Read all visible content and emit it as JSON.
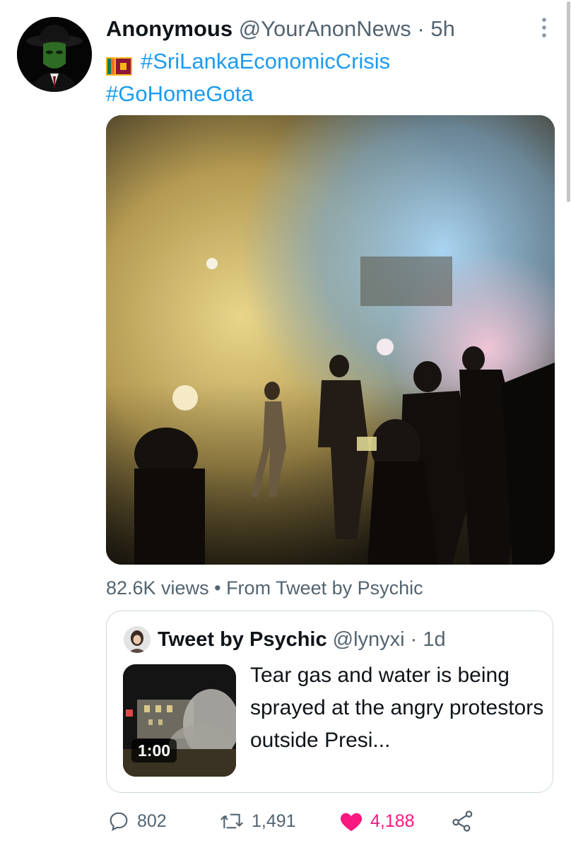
{
  "tweet": {
    "author_name": "Anonymous",
    "handle": "@YourAnonNews",
    "separator": "·",
    "time": "5h",
    "hashtag1": "#SriLankaEconomicCrisis",
    "hashtag2": "#GoHomeGota",
    "flag_icon": "sri-lanka-flag-icon"
  },
  "media": {
    "views": "82.6K views",
    "bullet": "•",
    "source": "From Tweet by Psychic"
  },
  "quote": {
    "label": "Tweet by Psychic",
    "handle": "@lynyxi",
    "separator": "·",
    "time": "1d",
    "text": "Tear gas and water is being sprayed at the angry protestors outside Presi...",
    "duration": "1:00"
  },
  "actions": {
    "replies": "802",
    "retweets": "1,491",
    "likes": "4,188"
  },
  "colors": {
    "link": "#1d9bf0",
    "like": "#f91880",
    "secondary": "#536471",
    "border": "#cfd9de"
  }
}
